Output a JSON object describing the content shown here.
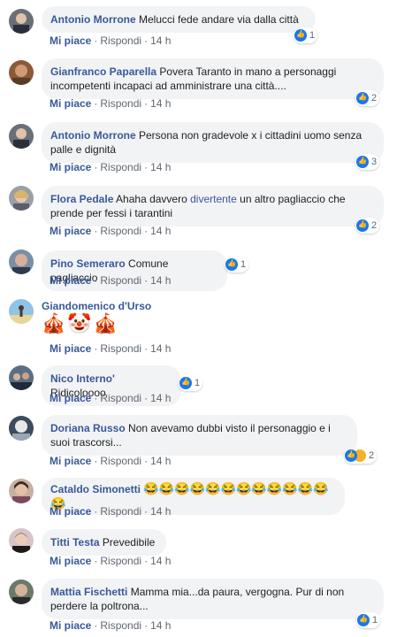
{
  "ui": {
    "like_label": "Mi piace",
    "reply_label": "Rispondi",
    "dot": "·"
  },
  "comments": [
    {
      "author": "Antonio Morrone",
      "text": "Melucci fede andare via dalla città",
      "time": "14 h",
      "reactions": "1"
    },
    {
      "author": "Gianfranco Paparella",
      "text": "Povera Taranto in mano a personaggi incompetenti incapaci ad amministrare una città....",
      "time": "14 h",
      "reactions": "2"
    },
    {
      "author": "Antonio Morrone",
      "text": "Persona non gradevole x i cittadini uomo senza palle e dignità",
      "time": "14 h",
      "reactions": "3"
    },
    {
      "author": "Flora Pedale",
      "text_before": "Ahaha davvero ",
      "link": "divertente",
      "text_after": " un altro pagliaccio che prende per fessi i tarantini",
      "time": "14 h",
      "reactions": "2"
    },
    {
      "author": "Pino Semeraro",
      "text": "Comune pagliaccio",
      "time": "14 h",
      "reactions": "1"
    },
    {
      "author": "Giandomenico d'Urso",
      "emoji": "🎪🤡🎪",
      "time": "14 h"
    },
    {
      "author": "Nico Interno'",
      "text": "Ridicoloooo",
      "time": "14 h",
      "reactions": "1"
    },
    {
      "author": "Doriana Russo",
      "text": "Non avevamo dubbi visto il personaggio e i suoi trascorsi...",
      "time": "14 h",
      "reactions": "2"
    },
    {
      "author": "Cataldo Simonetti",
      "emoji": "😂😂😂😂😂😂😂😂😂😂😂😂😂",
      "time": "14 h"
    },
    {
      "author": "Titti Testa",
      "text": "Prevedibile",
      "time": "14 h"
    },
    {
      "author": "Mattia Fischetti",
      "text": "Mamma mia...da paura, vergogna. Pur di non perdere la poltrona...",
      "time": "14 h",
      "reactions": "1"
    }
  ]
}
